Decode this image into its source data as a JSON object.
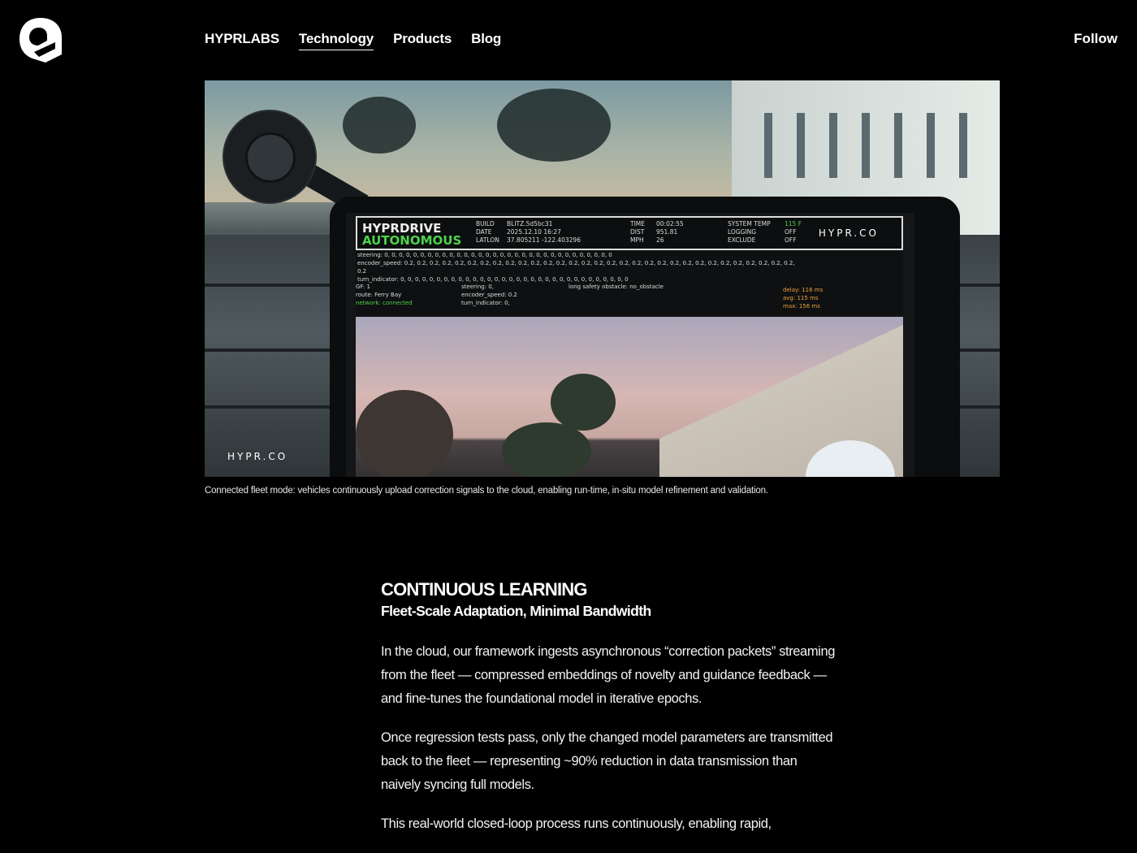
{
  "header": {
    "logo": "hyprlabs-logo-icon",
    "nav": [
      {
        "label": "HYPRLABS",
        "active": false
      },
      {
        "label": "Technology",
        "active": true
      },
      {
        "label": "Products",
        "active": false
      },
      {
        "label": "Blog",
        "active": false
      }
    ],
    "follow_label": "Follow"
  },
  "hero": {
    "hud": {
      "brand_line1": "HYPRDRIVE",
      "brand_line2": "AUTONOMOUS",
      "build_label": "BUILD",
      "build_value": "BLITZ.5d5bc31",
      "date_label": "DATE",
      "date_value": "2025.12.10  16:27",
      "latlon_label": "LATLON",
      "latlon_value": "37.805211   -122.403296",
      "time_label": "TIME",
      "time_value": "00:02:55",
      "dist_label": "DIST",
      "dist_value": "951.81",
      "mph_label": "MPH",
      "mph_value": "26",
      "systemtemp_label": "SYSTEM TEMP",
      "systemtemp_value": "115 F",
      "logging_label": "LOGGING",
      "logging_value": "OFF",
      "exclude_label": "EXCLUDE",
      "exclude_value": "OFF",
      "site": "HYPR.CO"
    },
    "telemetry": {
      "steering_line": "steering: 0, 0, 0, 0, 0, 0, 0, 0, 0, 0, 0, 0, 0, 0, 0, 0, 0, 0, 0, 0, 0, 0, 0, 0, 0, 0, 0, 0, 0, 0, 0, 0",
      "encoder_line": "encoder_speed: 0.2, 0.2, 0.2, 0.2, 0.2, 0.2, 0.2, 0.2, 0.2, 0.2, 0.2, 0.2, 0.2, 0.2, 0.2, 0.2, 0.2, 0.2, 0.2, 0.2, 0.2, 0.2, 0.2, 0.2, 0.2, 0.2, 0.2, 0.2, 0.2, 0.2, 0.2, 0.2",
      "turn_line": "turn_indicator: 0, 0, 0, 0, 0, 0, 0, 0, 0, 0, 0, 0, 0, 0, 0, 0, 0, 0, 0, 0, 0, 0, 0, 0, 0, 0, 0, 0, 0, 0, 0, 0",
      "gf": "GF: 1",
      "route": "route: Ferry Bay",
      "network": "network: connected",
      "steering_cur": "steering: 0,",
      "encoder_cur": "encoder_speed: 0.2",
      "turn_cur": "turn_indicator: 0,",
      "safety": "long safety obstacle: no_obstacle",
      "delay": "delay: 116 ms",
      "avg": "avg: 115 ms",
      "max": "max: 156 ms"
    },
    "watermark": "HYPR.CO"
  },
  "caption": "Connected fleet mode: vehicles continuously upload correction signals to the cloud, enabling run-time, in-situ model refinement and validation.",
  "article": {
    "title": "CONTINUOUS LEARNING",
    "subtitle": "Fleet-Scale Adaptation, Minimal Bandwidth",
    "paragraphs": [
      "In the cloud, our framework ingests asynchronous “correction packets” streaming from the fleet — compressed embeddings of novelty and guidance feedback — and fine-tunes the foundational model in iterative epochs.",
      "Once regression tests pass, only the changed model parameters are transmitted back to the fleet — representing ~90% reduction in data transmission than naively syncing full models.",
      "This real-world closed-loop process runs continuously, enabling rapid,"
    ]
  }
}
